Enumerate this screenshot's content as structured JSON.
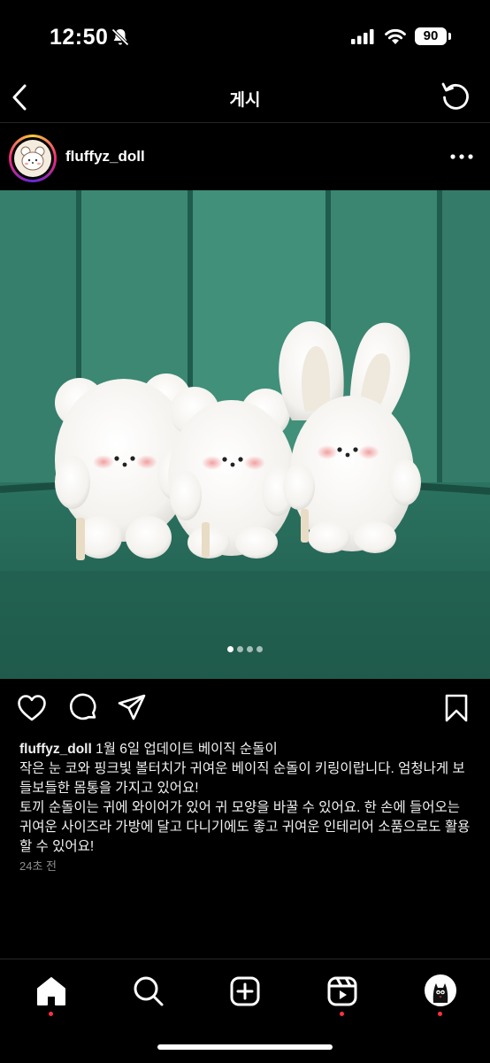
{
  "status_bar": {
    "time": "12:50",
    "battery": "90"
  },
  "header": {
    "title": "게시"
  },
  "post": {
    "username": "fluffyz_doll",
    "image_count": 4,
    "active_image": 1,
    "caption": {
      "username": "fluffyz_doll",
      "line1": " 1월 6일 업데이트 베이직 순돌이",
      "paragraph1": "작은 눈 코와 핑크빛 볼터치가 귀여운 베이직 순돌이 키링이랍니다. 엄청나게 보들보들한 몸통을 가지고 있어요!",
      "paragraph2": "토끼 순돌이는 귀에 와이어가 있어 귀 모양을 바꿀 수 있어요. 한 손에 들어오는 귀여운 사이즈라 가방에 달고 다니기에도 좋고 귀여운 인테리어 소품으로도 활용할 수 있어요!"
    },
    "timestamp": "24초 전"
  },
  "colors": {
    "background": "#000000",
    "notification": "#ff3040",
    "sofa": "#2f7a67"
  },
  "icons": {
    "header": [
      "back-icon",
      "refresh-icon"
    ],
    "post_actions": [
      "heart-icon",
      "comment-icon",
      "share-icon",
      "bookmark-icon"
    ],
    "tabs": [
      "home-icon",
      "search-icon",
      "create-icon",
      "reels-icon",
      "profile-avatar"
    ]
  }
}
